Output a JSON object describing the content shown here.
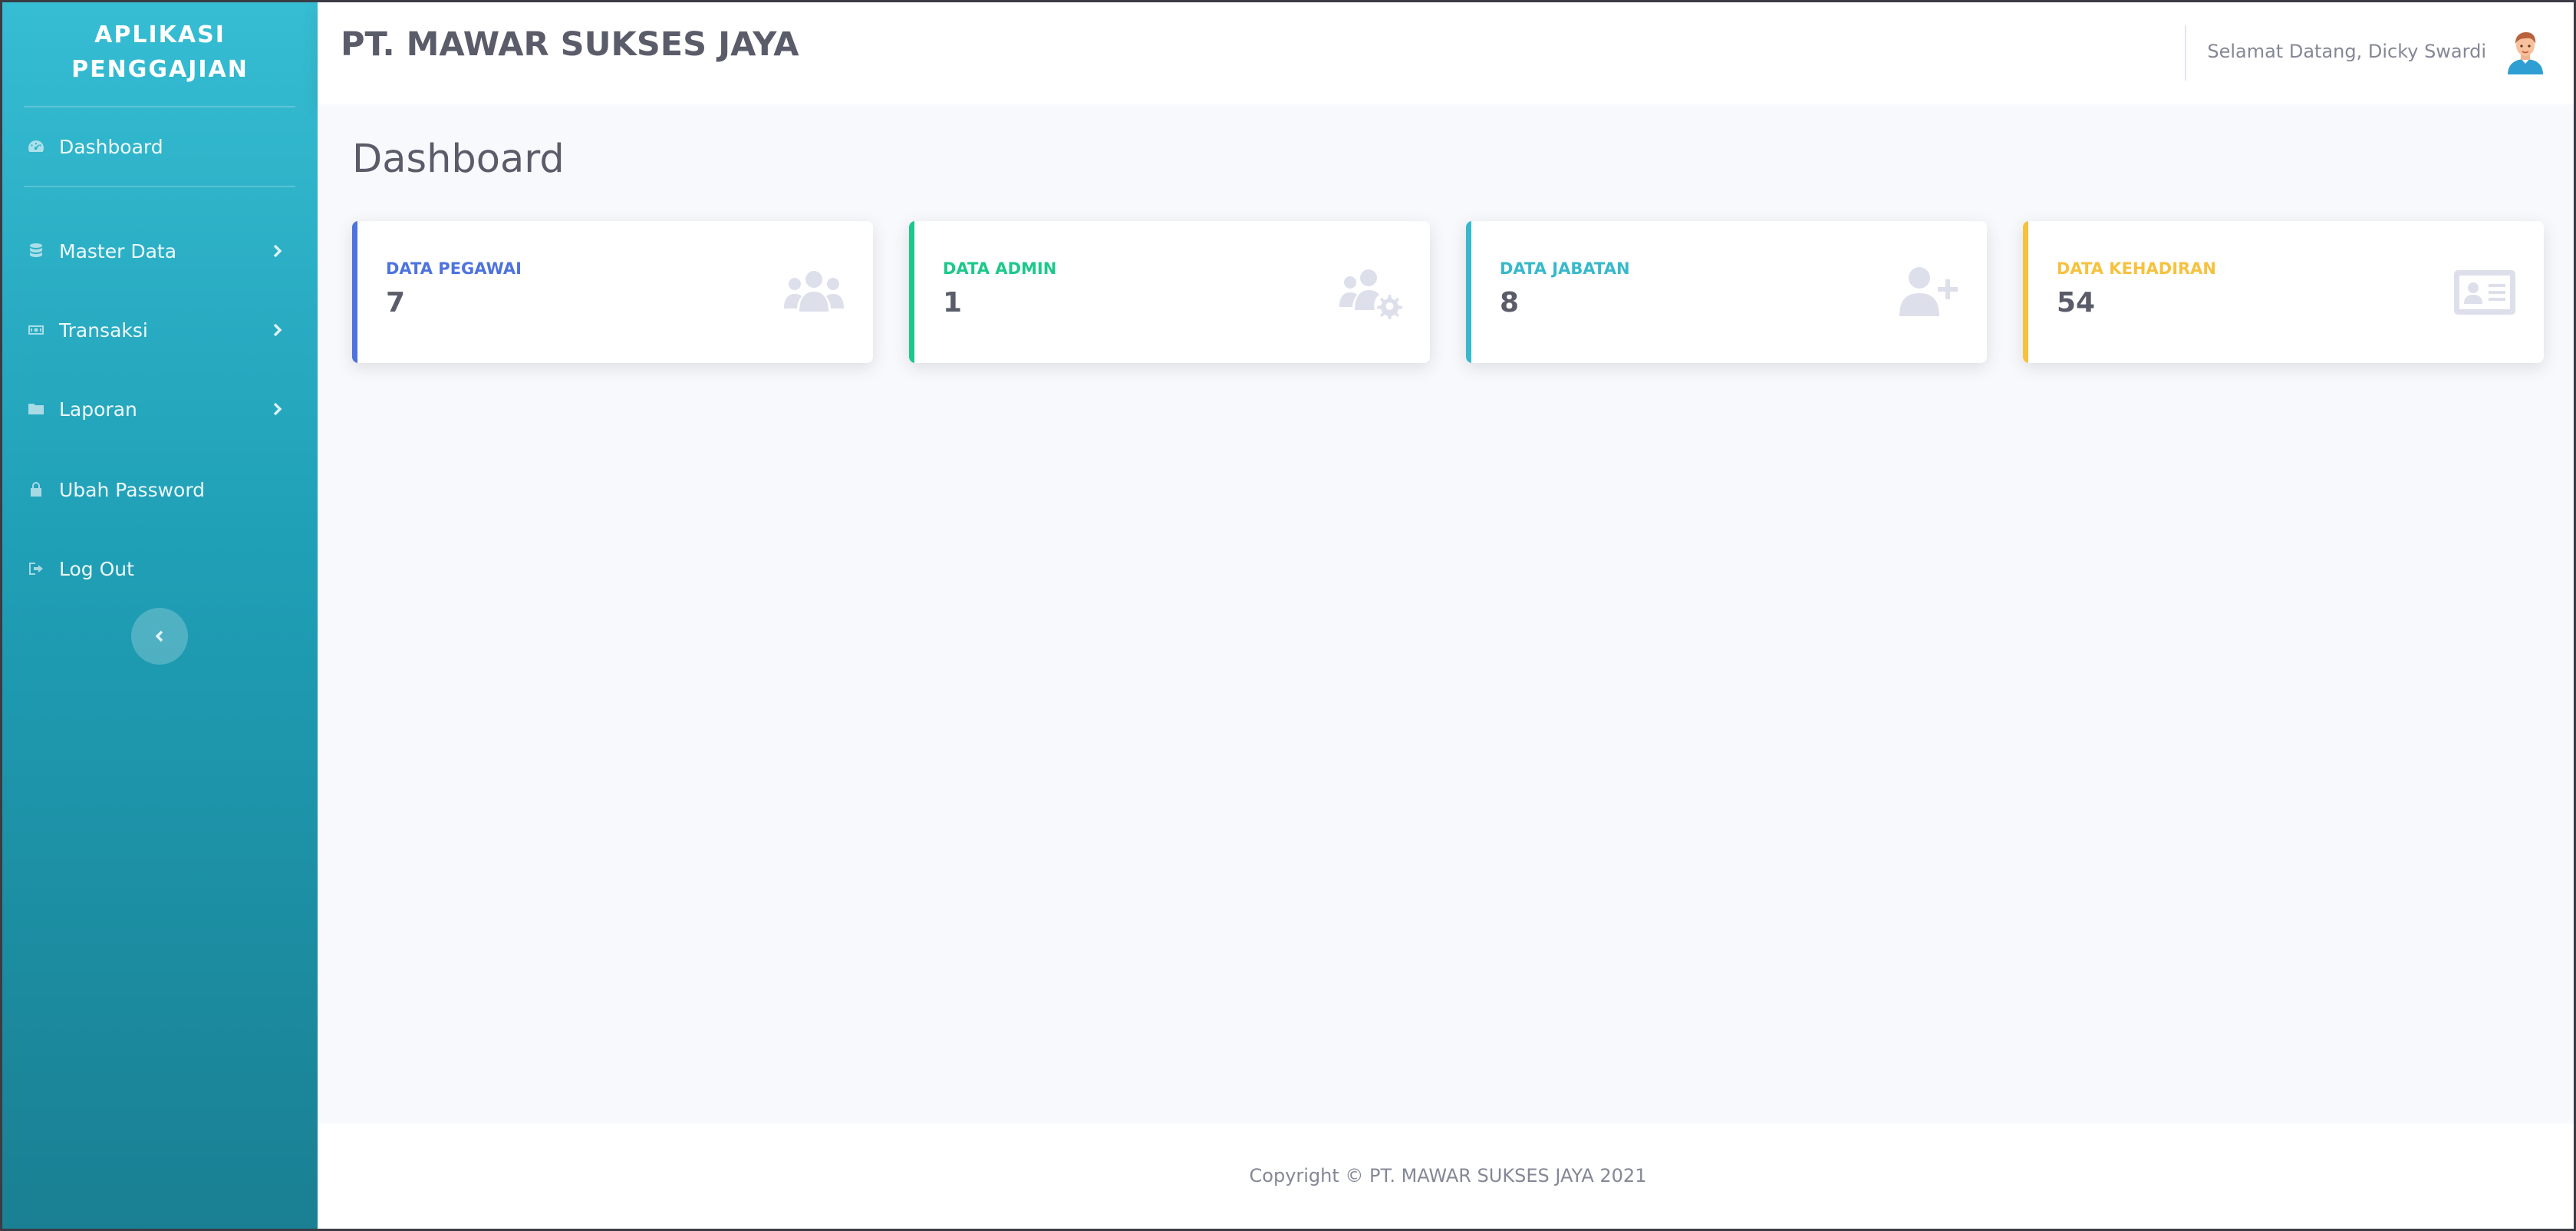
{
  "sidebar": {
    "brand_line1": "APLIKASI",
    "brand_line2": "PENGGAJIAN",
    "items": [
      {
        "label": "Dashboard",
        "icon": "tachometer-icon"
      },
      {
        "label": "Master Data",
        "icon": "database-icon",
        "has_submenu": true
      },
      {
        "label": "Transaksi",
        "icon": "money-bill-icon",
        "has_submenu": true
      },
      {
        "label": "Laporan",
        "icon": "folder-icon",
        "has_submenu": true
      },
      {
        "label": "Ubah Password",
        "icon": "lock-icon"
      },
      {
        "label": "Log Out",
        "icon": "sign-out-icon"
      }
    ],
    "toggle_icon": "chevron-left-icon"
  },
  "topbar": {
    "company": "PT. MAWAR SUKSES JAYA",
    "greeting": "Selamat Datang, Dicky Swardi",
    "avatar_icon": "user-avatar-icon"
  },
  "main": {
    "title": "Dashboard",
    "cards": [
      {
        "label": "DATA PEGAWAI",
        "value": "7",
        "color": "#4e73df",
        "icon": "users-icon"
      },
      {
        "label": "DATA ADMIN",
        "value": "1",
        "color": "#1cc88a",
        "icon": "users-cog-icon"
      },
      {
        "label": "DATA JABATAN",
        "value": "8",
        "color": "#36b9cc",
        "icon": "user-plus-icon"
      },
      {
        "label": "DATA KEHADIRAN",
        "value": "54",
        "color": "#f6c23e",
        "icon": "id-card-icon"
      }
    ]
  },
  "footer": {
    "copyright": "Copyright © PT. MAWAR SUKSES JAYA 2021"
  },
  "colors": {
    "sidebar_top": "#36bdd3",
    "sidebar_bottom": "#1a7f92",
    "background": "#f8f9fc",
    "text_dark": "#5a5c69",
    "text_muted": "#858796"
  }
}
